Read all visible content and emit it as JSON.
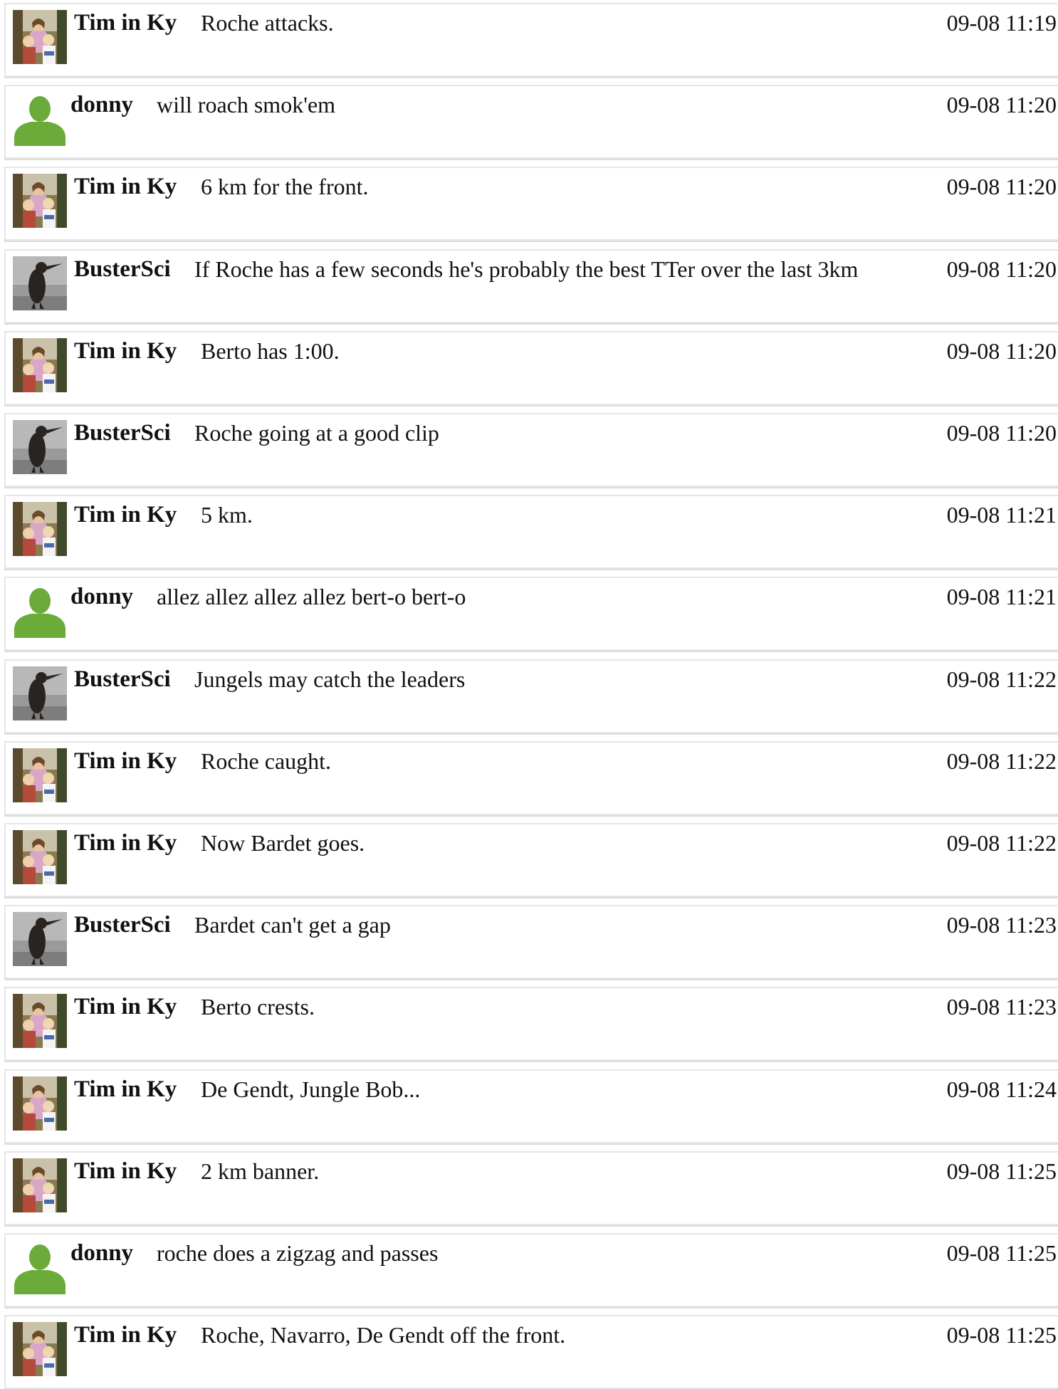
{
  "messages": [
    {
      "user": "Tim in Ky",
      "avatar": "family-photo-avatar",
      "text": "Roche attacks.",
      "time": "09-08 11:19"
    },
    {
      "user": "donny",
      "avatar": "default-user-silhouette-icon",
      "text": "will roach smok'em",
      "time": "09-08 11:20"
    },
    {
      "user": "Tim in Ky",
      "avatar": "family-photo-avatar",
      "text": "6 km for the front.",
      "time": "09-08 11:20"
    },
    {
      "user": "BusterSci",
      "avatar": "penguin-photo-avatar",
      "text": "If Roche has a few seconds he's probably the best TTer over the last 3km",
      "time": "09-08 11:20"
    },
    {
      "user": "Tim in Ky",
      "avatar": "family-photo-avatar",
      "text": "Berto has 1:00.",
      "time": "09-08 11:20"
    },
    {
      "user": "BusterSci",
      "avatar": "penguin-photo-avatar",
      "text": "Roche going at a good clip",
      "time": "09-08 11:20"
    },
    {
      "user": "Tim in Ky",
      "avatar": "family-photo-avatar",
      "text": "5 km.",
      "time": "09-08 11:21"
    },
    {
      "user": "donny",
      "avatar": "default-user-silhouette-icon",
      "text": "allez allez allez allez bert-o bert-o",
      "time": "09-08 11:21"
    },
    {
      "user": "BusterSci",
      "avatar": "penguin-photo-avatar",
      "text": "Jungels may catch the leaders",
      "time": "09-08 11:22"
    },
    {
      "user": "Tim in Ky",
      "avatar": "family-photo-avatar",
      "text": "Roche caught.",
      "time": "09-08 11:22"
    },
    {
      "user": "Tim in Ky",
      "avatar": "family-photo-avatar",
      "text": "Now Bardet goes.",
      "time": "09-08 11:22"
    },
    {
      "user": "BusterSci",
      "avatar": "penguin-photo-avatar",
      "text": "Bardet can't get a gap",
      "time": "09-08 11:23"
    },
    {
      "user": "Tim in Ky",
      "avatar": "family-photo-avatar",
      "text": "Berto crests.",
      "time": "09-08 11:23"
    },
    {
      "user": "Tim in Ky",
      "avatar": "family-photo-avatar",
      "text": "De Gendt, Jungle Bob...",
      "time": "09-08 11:24"
    },
    {
      "user": "Tim in Ky",
      "avatar": "family-photo-avatar",
      "text": "2 km banner.",
      "time": "09-08 11:25"
    },
    {
      "user": "donny",
      "avatar": "default-user-silhouette-icon",
      "text": "roche does a zigzag and passes",
      "time": "09-08 11:25"
    },
    {
      "user": "Tim in Ky",
      "avatar": "family-photo-avatar",
      "text": "Roche, Navarro, De Gendt off the front.",
      "time": "09-08 11:25"
    }
  ]
}
